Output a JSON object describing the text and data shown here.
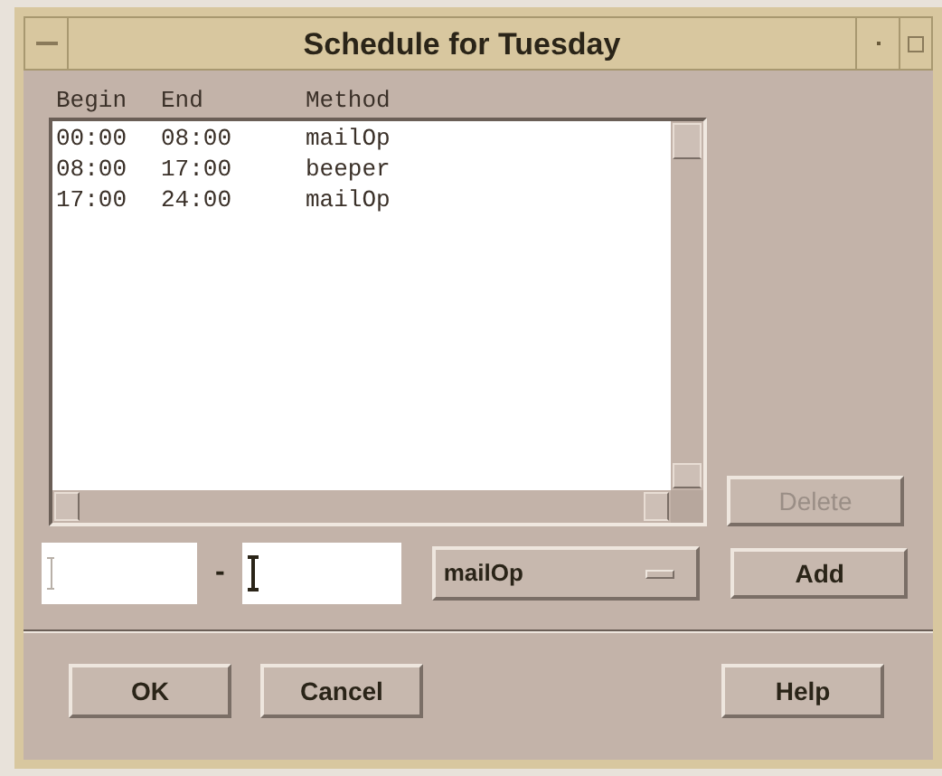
{
  "window": {
    "title": "Schedule for  Tuesday"
  },
  "list": {
    "columns": [
      "Begin",
      "End",
      "Method"
    ],
    "rows": [
      {
        "cells": [
          "00:00",
          "08:00",
          "mailOp"
        ]
      },
      {
        "cells": [
          "08:00",
          "17:00",
          "beeper"
        ]
      },
      {
        "cells": [
          "17:00",
          "24:00",
          "mailOp"
        ]
      }
    ]
  },
  "side_buttons": [
    {
      "label": "Delete",
      "disabled": true
    }
  ],
  "entry": {
    "begin_field": {
      "focused": false
    },
    "separator": "-",
    "end_field": {
      "focused": true
    },
    "method_menu": {
      "value": "mailOp"
    },
    "add_button": {
      "label": "Add",
      "disabled": false
    }
  },
  "buttons": [
    "OK",
    "Cancel",
    "Help"
  ]
}
